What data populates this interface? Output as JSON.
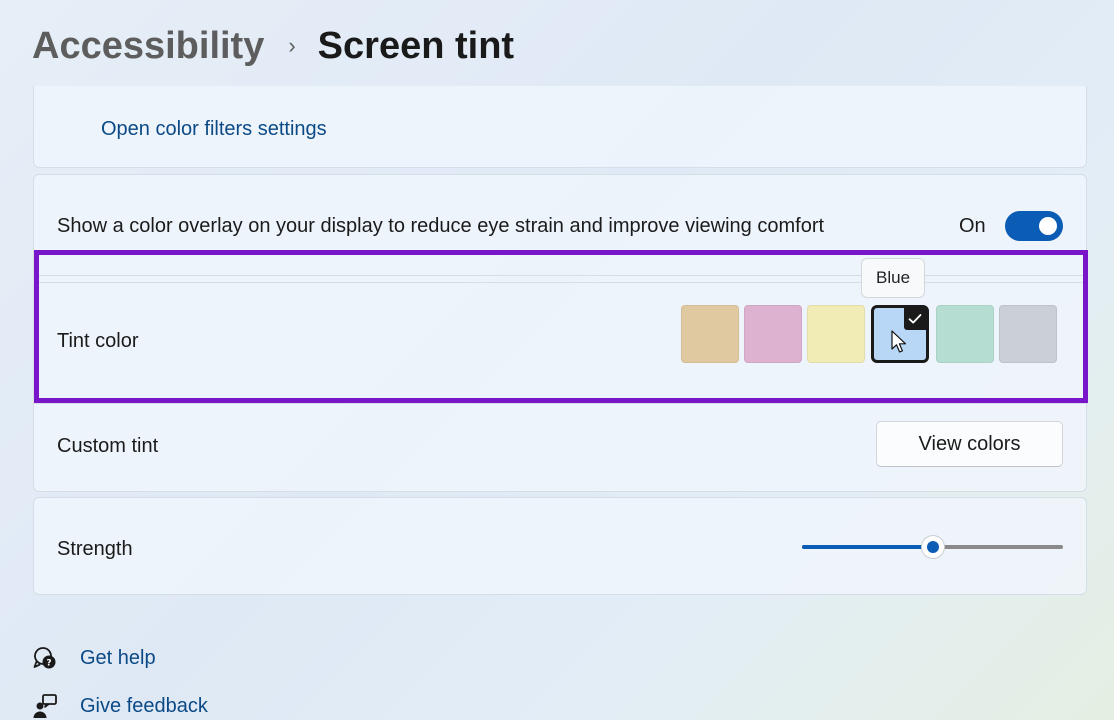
{
  "breadcrumb": {
    "parent": "Accessibility",
    "separator": "›",
    "current": "Screen tint"
  },
  "color_filters": {
    "link_label": "Open color filters settings"
  },
  "overlay": {
    "description": "Show a color overlay on your display to reduce eye strain and improve viewing comfort",
    "toggle_label": "On",
    "toggle_on": true
  },
  "tint": {
    "label": "Tint color",
    "tooltip": "Blue",
    "selected": "Blue",
    "swatches": [
      {
        "name": "Tan",
        "color": "#e0c9a0"
      },
      {
        "name": "Pink",
        "color": "#ddb1d0"
      },
      {
        "name": "Yellow",
        "color": "#f1ebb5"
      },
      {
        "name": "Blue",
        "color": "#b8d7f6"
      },
      {
        "name": "Green",
        "color": "#b6ddd1"
      },
      {
        "name": "Gray",
        "color": "#cad0d6"
      }
    ]
  },
  "custom_tint": {
    "label": "Custom tint",
    "button_label": "View colors"
  },
  "strength": {
    "label": "Strength",
    "value_fraction": 0.5
  },
  "footer": {
    "get_help": "Get help",
    "give_feedback": "Give feedback"
  },
  "colors": {
    "accent": "#0b5cb5",
    "highlight_frame": "#7a16c9",
    "link": "#0b4a86"
  }
}
